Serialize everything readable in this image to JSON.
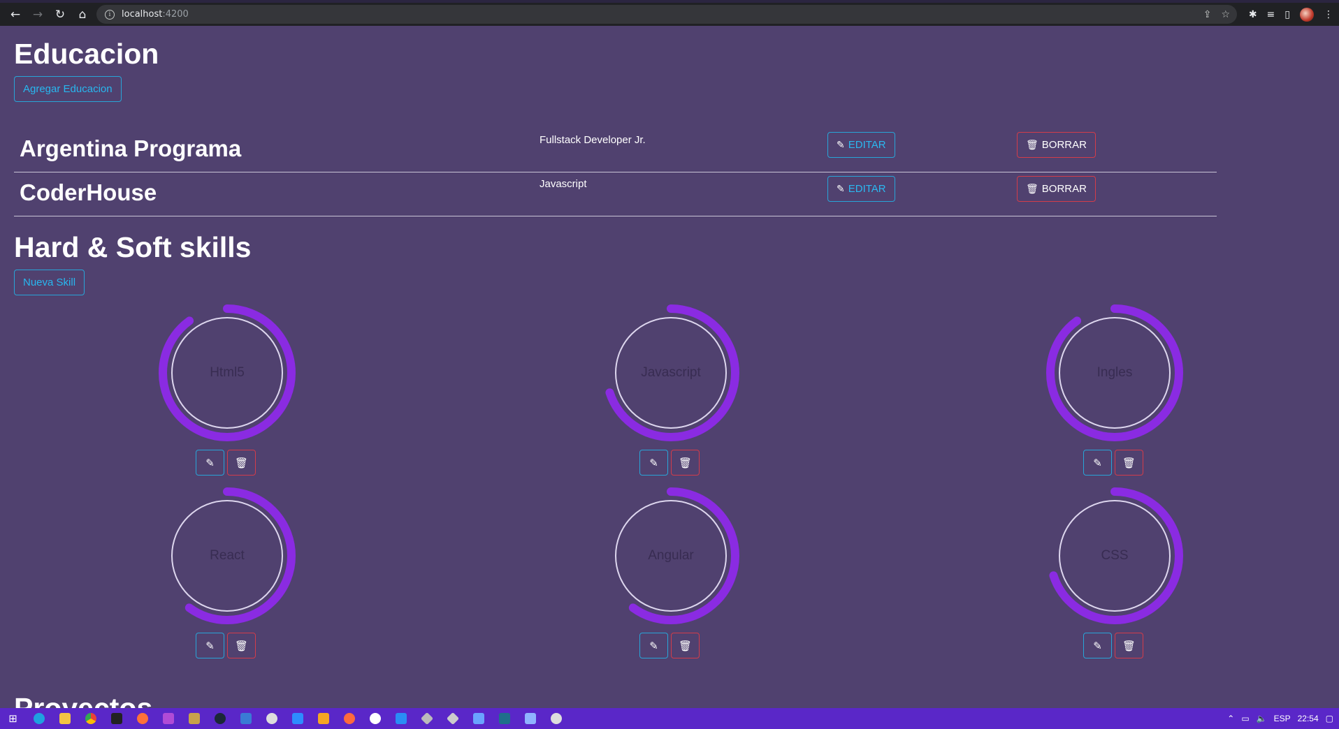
{
  "browser": {
    "url_host": "localhost",
    "url_port": ":4200",
    "back_icon": "←",
    "forward_icon": "→",
    "reload_icon": "↻",
    "home_icon": "⌂"
  },
  "educacion": {
    "title": "Educacion",
    "add_button": "Agregar Educacion",
    "items": [
      {
        "title": "Argentina Programa",
        "description": "Fullstack Developer Jr.",
        "edit_label": "EDITAR",
        "delete_label": "BORRAR"
      },
      {
        "title": "CoderHouse",
        "description": "Javascript",
        "edit_label": "EDITAR",
        "delete_label": "BORRAR"
      }
    ]
  },
  "skills": {
    "title": "Hard & Soft skills",
    "add_button": "Nueva Skill",
    "accent_color": "#8a2be2",
    "items": [
      {
        "name": "Html5",
        "percent": 90
      },
      {
        "name": "Javascript",
        "percent": 70
      },
      {
        "name": "Ingles",
        "percent": 90
      },
      {
        "name": "React",
        "percent": 60
      },
      {
        "name": "Angular",
        "percent": 60
      },
      {
        "name": "CSS",
        "percent": 70
      }
    ]
  },
  "proyectos": {
    "title": "Proyectos"
  },
  "taskbar": {
    "language": "ESP",
    "time": "22:54"
  }
}
